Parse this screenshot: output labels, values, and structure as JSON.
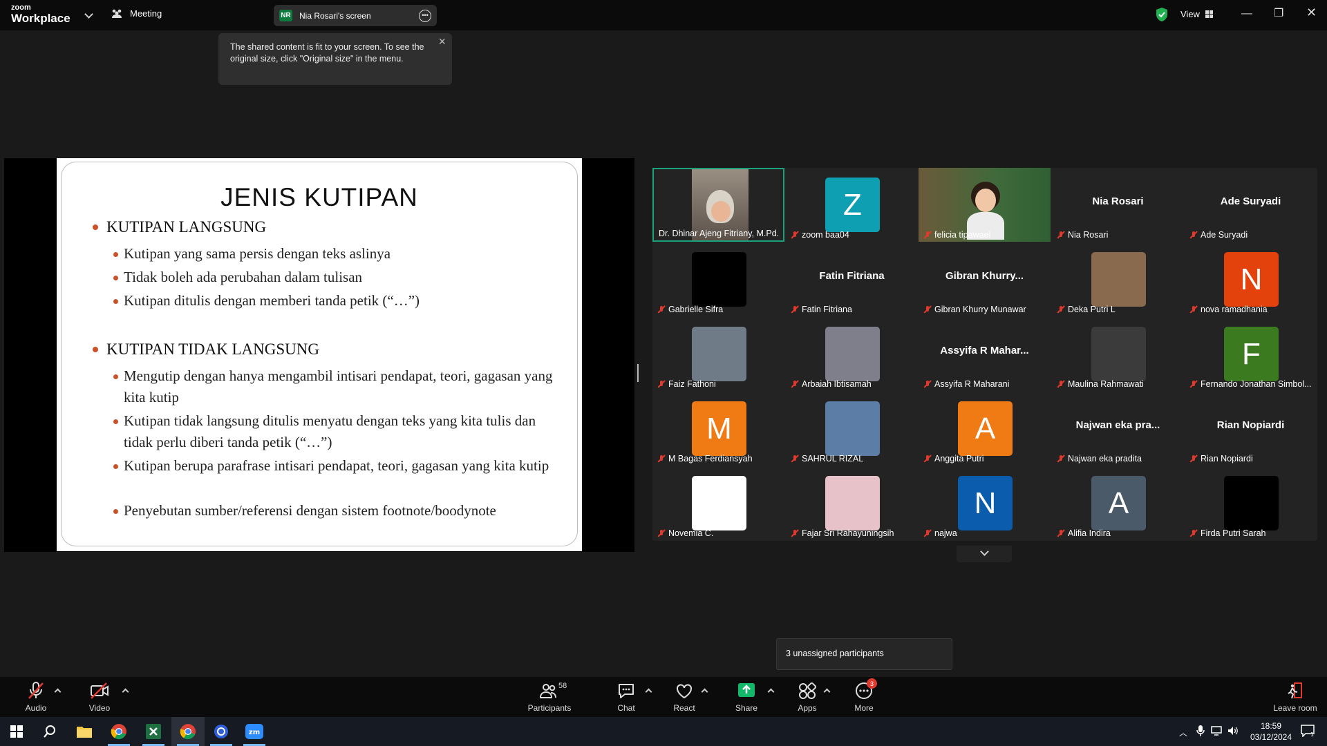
{
  "titlebar": {
    "brand_small": "zoom",
    "brand_big": "Workplace",
    "meeting_label": "Meeting",
    "share_initials": "NR",
    "share_label": "Nia Rosari's screen",
    "view_label": "View"
  },
  "tooltip": {
    "text": "The shared content is fit to your screen. To see the original size, click \"Original size\" in the menu."
  },
  "slide": {
    "title": "JENIS KUTIPAN",
    "section1": "KUTIPAN LANGSUNG",
    "section1_items": [
      "Kutipan yang sama persis dengan teks aslinya",
      "Tidak boleh ada perubahan dalam tulisan",
      "Kutipan ditulis dengan memberi tanda petik (“…”)"
    ],
    "section2": "KUTIPAN TIDAK LANGSUNG",
    "section2_items": [
      "Mengutip dengan hanya mengambil intisari pendapat, teori, gagasan yang kita kutip",
      "Kutipan tidak langsung ditulis menyatu dengan teks yang kita tulis dan tidak perlu diberi tanda petik (“…”)",
      "Kutipan berupa parafrase intisari pendapat, teori, gagasan yang kita kutip",
      "Penyebutan sumber/referensi dengan sistem footnote/boodynote"
    ]
  },
  "gallery": {
    "tiles": [
      {
        "name": "Dr. Dhinar Ajeng Fitriany, M.Pd.",
        "kind": "video"
      },
      {
        "name": "zoom baa04",
        "kind": "letter",
        "letter": "Z",
        "color": "#0e9fb3"
      },
      {
        "name": "felicia tipawael",
        "kind": "video"
      },
      {
        "name": "Nia Rosari",
        "kind": "name",
        "label": "Nia Rosari"
      },
      {
        "name": "Ade Suryadi",
        "kind": "name",
        "label": "Ade Suryadi"
      },
      {
        "name": "Gabrielle Sifra",
        "kind": "photo",
        "color": "#000000"
      },
      {
        "name": "Fatin Fitriana",
        "kind": "name",
        "label": "Fatin Fitriana"
      },
      {
        "name": "Gibran Khurry Munawar",
        "kind": "name",
        "label": "Gibran Khurry..."
      },
      {
        "name": "Deka Putri L",
        "kind": "photo",
        "color": "#8a6a4e"
      },
      {
        "name": "nova ramadhania",
        "kind": "letter",
        "letter": "N",
        "color": "#e3420d"
      },
      {
        "name": "Faiz Fathoni",
        "kind": "photo",
        "color": "#6f7b86"
      },
      {
        "name": "Arbaiah Ibtisamah",
        "kind": "photo",
        "color": "#7e7f8a"
      },
      {
        "name": "Assyifa R Maharani",
        "kind": "name",
        "label": "Assyifa R Mahar..."
      },
      {
        "name": "Maulina Rahmawati",
        "kind": "photo",
        "color": "#3b3b3b"
      },
      {
        "name": "Fernando Jonathan Simbol...",
        "kind": "letter",
        "letter": "F",
        "color": "#3b7a1e"
      },
      {
        "name": "M Bagas Ferdiansyah",
        "kind": "letter",
        "letter": "M",
        "color": "#f07a14"
      },
      {
        "name": "SAHRUL RIZAL",
        "kind": "photo",
        "color": "#5c7ea6"
      },
      {
        "name": "Anggita Putri",
        "kind": "letter",
        "letter": "A",
        "color": "#f07a14"
      },
      {
        "name": "Najwan eka pradita",
        "kind": "name",
        "label": "Najwan eka pra..."
      },
      {
        "name": "Rian Nopiardi",
        "kind": "name",
        "label": "Rian Nopiardi"
      },
      {
        "name": "Novemia C.",
        "kind": "photo",
        "color": "#ffffff"
      },
      {
        "name": "Fajar Sri Rahayuningsih",
        "kind": "photo",
        "color": "#e7c3c9"
      },
      {
        "name": "najwa",
        "kind": "letter",
        "letter": "N",
        "color": "#0b5cad"
      },
      {
        "name": "Alifia Indira",
        "kind": "letter",
        "letter": "A",
        "color": "#4a5a68"
      },
      {
        "name": "Firda Putri Sarah",
        "kind": "photo",
        "color": "#000000"
      }
    ]
  },
  "breakout": {
    "unassigned": "3 unassigned participants"
  },
  "toolbar": {
    "audio": "Audio",
    "video": "Video",
    "participants": "Participants",
    "participants_count": "58",
    "chat": "Chat",
    "react": "React",
    "share": "Share",
    "apps": "Apps",
    "more": "More",
    "more_badge": "3",
    "leave": "Leave room"
  },
  "taskbar": {
    "time": "18:59",
    "date": "03/12/2024",
    "notif_count": "1"
  },
  "colors": {
    "accent_green": "#1aa37a",
    "share_green": "#12b76a",
    "mute_red": "#e0392e"
  }
}
